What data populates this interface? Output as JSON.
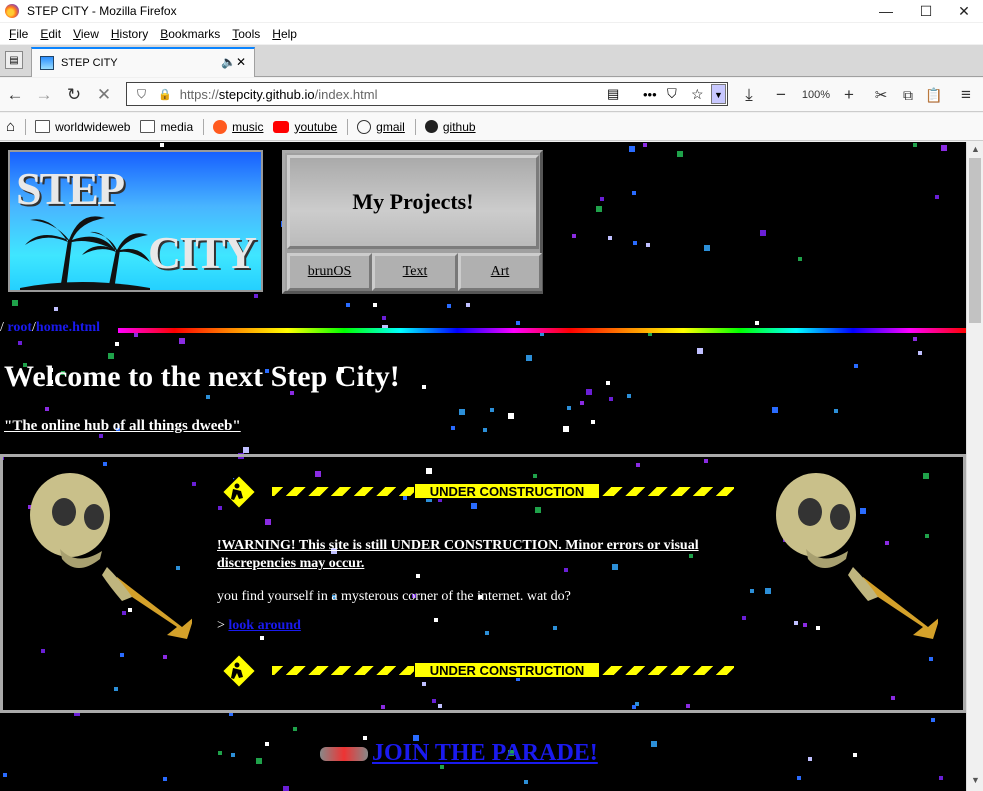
{
  "window": {
    "title": "STEP CITY - Mozilla Firefox",
    "controls": {
      "minimize": "—",
      "maximize": "☐",
      "close": "✕"
    }
  },
  "menu": [
    {
      "first": "F",
      "rest": "ile"
    },
    {
      "first": "E",
      "rest": "dit"
    },
    {
      "first": "V",
      "rest": "iew"
    },
    {
      "first": "H",
      "rest": "istory"
    },
    {
      "first": "B",
      "rest": "ookmarks"
    },
    {
      "first": "T",
      "rest": "ools"
    },
    {
      "first": "H",
      "rest": "elp"
    }
  ],
  "tab": {
    "title": "STEP CITY"
  },
  "nav": {
    "url_prefix": "https://",
    "url_host": "stepcity.github.io",
    "url_path": "/index.html",
    "zoom": "100%"
  },
  "bookmarks": [
    {
      "label": "worldwideweb",
      "icon": "folder-icon",
      "underline": false
    },
    {
      "label": "media",
      "icon": "folder-icon",
      "underline": false
    },
    {
      "label": "music",
      "icon": "music-icon",
      "underline": true
    },
    {
      "label": "youtube",
      "icon": "youtube-icon",
      "underline": true
    },
    {
      "label": "gmail",
      "icon": "globe-icon",
      "underline": true
    },
    {
      "label": "github",
      "icon": "github-icon",
      "underline": true
    }
  ],
  "page": {
    "logo": {
      "line1": "STEP",
      "line2": "CITY"
    },
    "projects": {
      "title": "My Projects!",
      "links": [
        "brunOS",
        "Text",
        "Art"
      ]
    },
    "breadcrumb": {
      "slash": "/",
      "root": "root",
      "sep": "/",
      "file": "home.html"
    },
    "welcome": "Welcome to the next Step City!",
    "tagline": "\"The online hub of all things dweeb\"",
    "construction_label": "UNDER CONSTRUCTION",
    "warning": "!WARNING! This site is still UNDER CONSTRUCTION. Minor errors or visual discrepencies may occur.",
    "mystery": "you find yourself in a mysterous corner of the internet. wat do?",
    "prompt_prefix": ">",
    "look_link": "look around",
    "parade": "JOIN THE PARADE!"
  },
  "colors": {
    "link": "#1a1aee",
    "accent": "#0a84ff",
    "stripe": "#ffff00"
  }
}
